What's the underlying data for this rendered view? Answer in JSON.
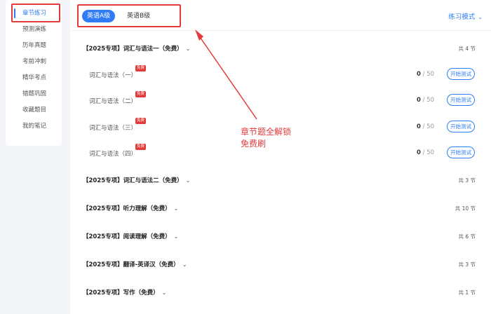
{
  "sidebar": {
    "items": [
      {
        "label": "章节练习",
        "active": true
      },
      {
        "label": "预测演练"
      },
      {
        "label": "历年真题"
      },
      {
        "label": "考前冲刺"
      },
      {
        "label": "精华考点"
      },
      {
        "label": "错题巩固"
      },
      {
        "label": "收藏题目"
      },
      {
        "label": "我的笔记"
      }
    ]
  },
  "header": {
    "levels": [
      "英语A级",
      "英语B级"
    ],
    "active_level": "英语A级",
    "mode_label": "练习模式",
    "mode_icon": "chevron-down-icon"
  },
  "sections": [
    {
      "title": "【2025专项】词汇与语法一（免费）",
      "count": "共 4 节",
      "expanded": true,
      "items": [
        {
          "name": "词汇与语法（一）",
          "badge": "免费",
          "done": "0",
          "total": "/ 50",
          "action": "开始测试"
        },
        {
          "name": "词汇与语法（二）",
          "badge": "免费",
          "done": "0",
          "total": "/ 50",
          "action": "开始测试"
        },
        {
          "name": "词汇与语法（三）",
          "badge": "免费",
          "done": "0",
          "total": "/ 50",
          "action": "开始测试"
        },
        {
          "name": "词汇与语法（四）",
          "badge": "免费",
          "done": "0",
          "total": "/ 50",
          "action": "开始测试"
        }
      ]
    },
    {
      "title": "【2025专项】词汇与语法二（免费）",
      "count": "共 3 节"
    },
    {
      "title": "【2025专项】听力理解（免费）",
      "count": "共 10 节"
    },
    {
      "title": "【2025专项】阅读理解（免费）",
      "count": "共 6 节"
    },
    {
      "title": "【2025专项】翻译-英译汉（免费）",
      "count": "共 3 节"
    },
    {
      "title": "【2025专项】写作（免费）",
      "count": "共 1 节"
    }
  ],
  "annotation": {
    "line1": "章节题全解锁",
    "line2": "免费刷",
    "color": "#e23b3b"
  },
  "colors": {
    "accent": "#2f7cf6",
    "highlight": "#e23b3b"
  }
}
